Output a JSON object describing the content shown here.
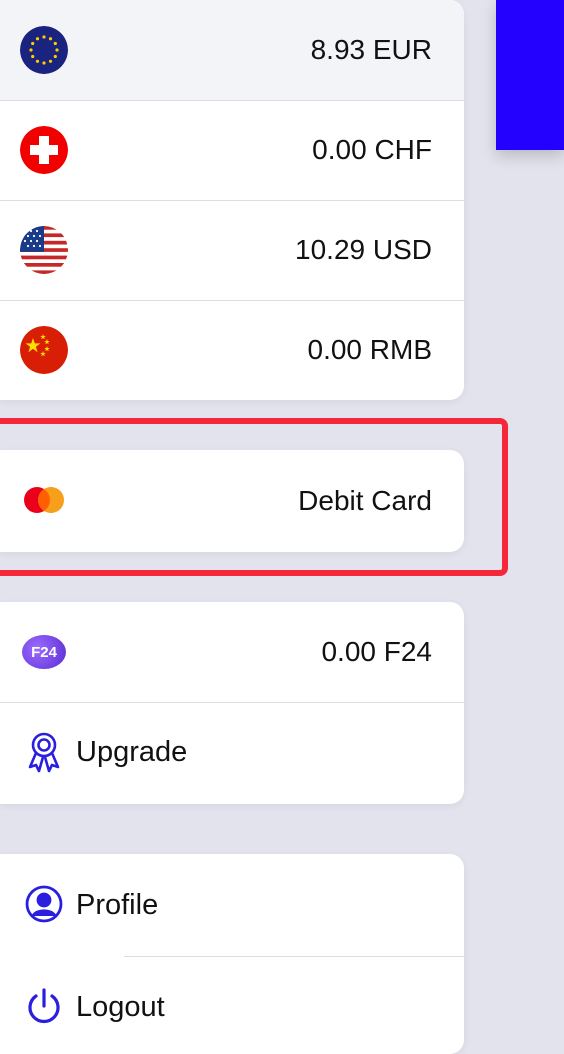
{
  "colors": {
    "background": "#e3e3ee",
    "accent": "#2400ff",
    "highlight": "#f4283a",
    "icon_blue": "#2a1ee0",
    "f24_purple": "#7a4bd8"
  },
  "accounts": [
    {
      "value": "8.93 EUR",
      "icon": "eu-flag-icon",
      "selected": true
    },
    {
      "value": "0.00 CHF",
      "icon": "swiss-flag-icon"
    },
    {
      "value": "10.29 USD",
      "icon": "us-flag-icon"
    },
    {
      "value": "0.00 RMB",
      "icon": "china-flag-icon"
    }
  ],
  "card": {
    "label": "Debit Card",
    "icon": "mastercard-icon"
  },
  "f24": {
    "value": "0.00 F24",
    "icon_text": "F24",
    "icon": "f24-token-icon"
  },
  "upgrade": {
    "label": "Upgrade",
    "icon": "award-ribbon-icon"
  },
  "menu": {
    "profile": {
      "label": "Profile",
      "icon": "user-circle-icon"
    },
    "logout": {
      "label": "Logout",
      "icon": "power-icon"
    }
  }
}
